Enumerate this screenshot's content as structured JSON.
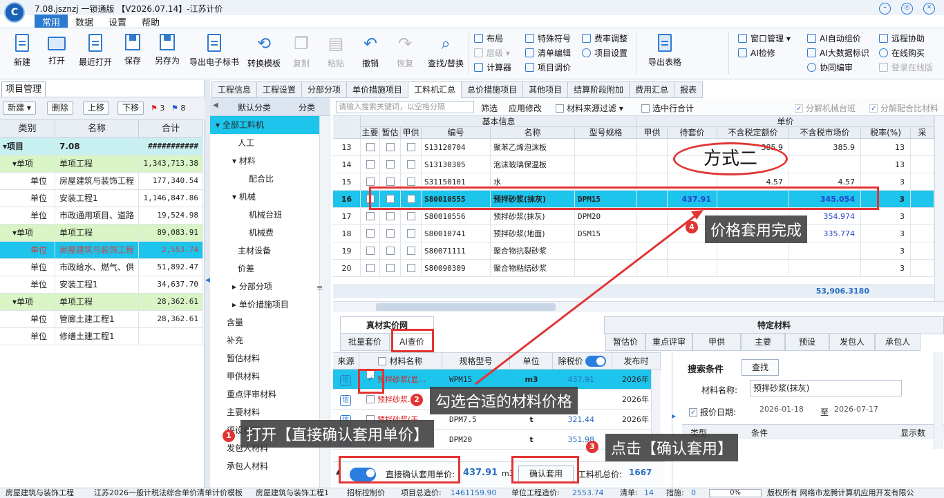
{
  "app": {
    "title": "7.08.jsznzj 一锁通版 【V2026.07.14】-江苏计价",
    "logo": "C"
  },
  "menu": [
    "常用",
    "数据",
    "设置",
    "帮助"
  ],
  "ribbon": {
    "big": [
      {
        "label": "新建",
        "icon": "new-icon"
      },
      {
        "label": "打开",
        "icon": "open-icon"
      },
      {
        "label": "最近打开",
        "icon": "recent-icon"
      },
      {
        "label": "保存",
        "icon": "save-icon"
      },
      {
        "label": "另存为",
        "icon": "save-as-icon"
      },
      {
        "label": "导出电子标书",
        "icon": "export-icon"
      },
      {
        "label": "转换模板",
        "icon": "convert-icon"
      },
      {
        "label": "复制",
        "icon": "copy-icon"
      },
      {
        "label": "粘贴",
        "icon": "paste-icon"
      },
      {
        "label": "撤销",
        "icon": "undo-icon"
      },
      {
        "label": "恢复",
        "icon": "redo-icon"
      },
      {
        "label": "查找/替换",
        "icon": "find-icon"
      }
    ],
    "small1": [
      "布局",
      "层级",
      "计算器"
    ],
    "small2": [
      "特殊符号",
      "清单编辑",
      "项目调价"
    ],
    "small3": [
      "费率调整",
      "项目设置"
    ],
    "export": "导出表格",
    "small4": [
      "窗口管理",
      "AI检修"
    ],
    "small5": [
      "AI自动组价",
      "AI大数据标识",
      "协同编审"
    ],
    "small6": [
      "远程协助",
      "在线购买",
      "登录在线版"
    ]
  },
  "left": {
    "tab": "项目管理",
    "buttons": [
      "新建",
      "删除",
      "上移",
      "下移"
    ],
    "flags": [
      {
        "n": "3"
      },
      {
        "n": "8"
      }
    ],
    "headers": [
      "类别",
      "名称",
      "合计"
    ],
    "rows": [
      {
        "type": "项目",
        "name": "7.08",
        "total": "###########",
        "style": "root"
      },
      {
        "type": "单项",
        "name": "单项工程",
        "total": "1,343,713.38",
        "style": "g"
      },
      {
        "type": "单位",
        "name": "房屋建筑与装饰工程",
        "total": "177,340.54",
        "style": ""
      },
      {
        "type": "单位",
        "name": "安装工程1",
        "total": "1,146,847.86",
        "style": ""
      },
      {
        "type": "单位",
        "name": "市政通用项目、道路",
        "total": "19,524.98",
        "style": ""
      },
      {
        "type": "单项",
        "name": "单项工程",
        "total": "89,083.91",
        "style": "g"
      },
      {
        "type": "单位",
        "name": "房屋建筑与装饰工程",
        "total": "2,553.74",
        "style": "sel"
      },
      {
        "type": "单位",
        "name": "市政给水、燃气、供",
        "total": "51,892.47",
        "style": ""
      },
      {
        "type": "单位",
        "name": "安装工程1",
        "total": "34,637.70",
        "style": ""
      },
      {
        "type": "单项",
        "name": "单项工程",
        "total": "28,362.61",
        "style": "g"
      },
      {
        "type": "单位",
        "name": "管廊土建工程1",
        "total": "28,362.61",
        "style": ""
      },
      {
        "type": "单位",
        "name": "修缮土建工程1",
        "total": "",
        "style": ""
      }
    ]
  },
  "mid": {
    "tabs": [
      "默认分类",
      "分类"
    ],
    "items": [
      "全部工料机",
      "人工",
      "材料",
      "配合比",
      "机械",
      "机械台班",
      "机械费",
      "主材设备",
      "价差",
      "分部分项",
      "单价措施项目",
      "暂估材料",
      "甲供材料",
      "重点评审材料",
      "主要材料",
      "承包人材料"
    ],
    "items_b": [
      "补充",
      "暂估材料",
      "甲供材料",
      "重点评审材料",
      "主要材料",
      "评设材料",
      "发包人材料",
      "承包人材料",
      "含量"
    ]
  },
  "maintabs": [
    "工程信息",
    "工程设置",
    "分部分项",
    "单价措施项目",
    "工料机汇总",
    "总价措施项目",
    "其他项目",
    "结算阶段附加",
    "费用汇总",
    "报表"
  ],
  "gridtool": {
    "search_placeholder": "请输入搜索关键词，以空格分隔",
    "filter": "筛选",
    "apply": "应用修改",
    "source_filter": "材料来源过滤",
    "selected_subtotal": "选中行合计",
    "split_machine": "分解机械台班",
    "split_mix": "分解配合比材料"
  },
  "grid": {
    "group1": "基本信息",
    "group2": "单价",
    "headers": [
      "主要",
      "暂估",
      "甲供",
      "编号",
      "名称",
      "型号规格",
      "甲供",
      "待套价",
      "不含税定额价",
      "不含税市场价",
      "税率(%)",
      "采"
    ],
    "rows": [
      {
        "n": "13",
        "code": "S13120704",
        "name": "聚苯乙烯泡沫板",
        "spec": "",
        "quote": "",
        "dprice": "385.9",
        "mprice": "385.9",
        "tax": "13",
        "sel": false
      },
      {
        "n": "14",
        "code": "S13130305",
        "name": "泡沫玻璃保温板",
        "spec": "",
        "quote": "",
        "dprice": "",
        "mprice": "",
        "tax": "13",
        "sel": false
      },
      {
        "n": "15",
        "code": "S31150101",
        "name": "水",
        "spec": "",
        "quote": "",
        "dprice": "4.57",
        "mprice": "4.57",
        "tax": "3",
        "sel": false
      },
      {
        "n": "16",
        "code": "S80010555",
        "name": "预拌砂浆(抹灰)",
        "spec": "DPM15",
        "quote": "437.91",
        "dprice": "",
        "mprice": "345.054",
        "tax": "3",
        "sel": true
      },
      {
        "n": "17",
        "code": "S80010556",
        "name": "预拌砂浆(抹灰)",
        "spec": "DPM20",
        "quote": "",
        "dprice": "",
        "mprice": "354.974",
        "tax": "3",
        "sel": false
      },
      {
        "n": "18",
        "code": "S80010741",
        "name": "预拌砂浆(地面)",
        "spec": "DSM15",
        "quote": "",
        "dprice": "",
        "mprice": "335.774",
        "tax": "3",
        "sel": false
      },
      {
        "n": "19",
        "code": "S80071111",
        "name": "聚合物抗裂砂浆",
        "spec": "",
        "quote": "",
        "dprice": "",
        "mprice": "",
        "tax": "3",
        "sel": false
      },
      {
        "n": "20",
        "code": "S80090309",
        "name": "聚合物粘结砂浆",
        "spec": "",
        "quote": "",
        "dprice": "",
        "mprice": "",
        "tax": "3",
        "sel": false
      }
    ],
    "sum": "53,906.3180"
  },
  "bottom": {
    "left_title": "真材实价网",
    "right_title": "特定材料",
    "left_tabs": [
      "批量套价",
      "AI查价"
    ],
    "right_tabs": [
      "暂估价",
      "重点评审",
      "甲供",
      "主要",
      "预设",
      "发包人",
      "承包人"
    ],
    "headers": [
      "来源",
      "材料名称",
      "规格型号",
      "单位",
      "除税价",
      "发布时"
    ],
    "rows": [
      {
        "name": "预拌砂浆(显…",
        "spec": "WPM15",
        "unit": "m3",
        "price": "437.91",
        "date": "2026年",
        "sel": true
      },
      {
        "name": "预拌砂浆…",
        "spec": "",
        "unit": "",
        "price": "",
        "date": "2026年",
        "sel": false
      },
      {
        "name": "预拌砂浆(干…",
        "spec": "DPM7.5",
        "unit": "t",
        "price": "321.44",
        "date": "2026年",
        "sel": false
      },
      {
        "name": "",
        "spec": "DPM20",
        "unit": "t",
        "price": "351.98",
        "date": "",
        "sel": false
      }
    ],
    "search": {
      "title": "搜索条件",
      "btn": "查找",
      "name_label": "材料名称:",
      "name_value": "预拌砂浆(抹灰)",
      "date_label": "报价日期:",
      "date_from": "2026-01-18",
      "to": "至",
      "date_to": "2026-07-17",
      "col1": "类型",
      "col2": "条件",
      "col3": "显示数"
    },
    "direct_label": "直接确认套用单价:",
    "direct_value": "437.91",
    "direct_unit": "m3",
    "confirm_btn": "确认套用",
    "total_label": "工料机总价:",
    "total_value": "1667"
  },
  "status": [
    "房屋建筑与装饰工程",
    "江苏2026一般计税法综合单价清单计价模板",
    "房屋建筑与装饰工程1",
    "招标控制价",
    "项目总造价:",
    "1461159.90",
    "单位工程造价:",
    "2553.74",
    "清单:",
    "14",
    "措施:",
    "0",
    "0%",
    "版权所有 网络市龙腾计算机应用开发有限公"
  ],
  "annotations": {
    "oval": "方式二",
    "c1": "打开【直接确认套用单价】",
    "c2": "勾选合适的材料价格",
    "c3": "点击【确认套用】",
    "c4": "价格套用完成",
    "n1": "1",
    "n2": "2",
    "n3": "3",
    "n4": "4"
  },
  "colors": {
    "accent": "#2b79d0",
    "selection": "#1dc4ec",
    "group": "#d9f5c6",
    "annotation": "#e23434"
  }
}
